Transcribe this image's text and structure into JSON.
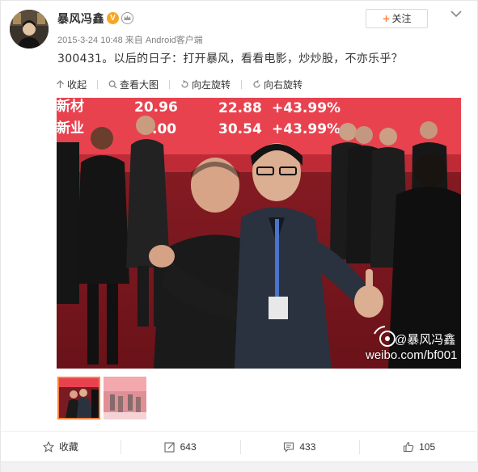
{
  "user": {
    "name": "暴风冯鑫",
    "verified_badge": "V"
  },
  "meta": {
    "timestamp": "2015-3-24 10:48",
    "source": "来自 Android客户端"
  },
  "follow": {
    "plus": "+",
    "label": "关注"
  },
  "post": {
    "text": "300431。以后的日子：打开暴风，看看电影，炒炒股，不亦乐乎？"
  },
  "media_toolbar": {
    "collapse": "收起",
    "view_large": "查看大图",
    "rotate_left": "向左旋转",
    "rotate_right": "向右旋转"
  },
  "photo": {
    "board_rows": [
      [
        "新材",
        "20.96",
        "22.88",
        "+43.99%"
      ],
      [
        "新业",
        ".00",
        "30.54",
        "+43.99%"
      ]
    ],
    "watermark_handle": "@暴风冯鑫",
    "watermark_url": "weibo.com/bf001"
  },
  "actions": {
    "favorite": "收藏",
    "repost": "643",
    "comment": "433",
    "like": "105"
  },
  "colors": {
    "accent": "#ff8140",
    "text": "#333333",
    "meta": "#808080"
  },
  "icons": [
    "collapse-arrow-icon",
    "search-icon",
    "rotate-left-icon",
    "rotate-right-icon",
    "star-icon",
    "repost-icon",
    "comment-icon",
    "thumbs-up-icon",
    "chevron-down-icon",
    "crown-icon"
  ]
}
